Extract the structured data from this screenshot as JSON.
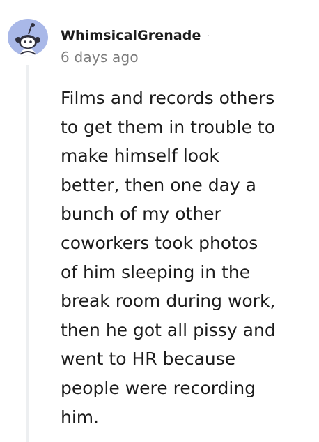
{
  "comment": {
    "username": "WhimsicalGrenade",
    "separator": "·",
    "timestamp": "6 days ago",
    "body_lines": [
      "Films and records others",
      "to get them in trouble to",
      "make himself look",
      "better, then one day a",
      "bunch of my other",
      "coworkers took photos",
      "of him sleeping in the",
      "break room during work,",
      "then he got all pissy and",
      "went to HR because",
      "people were recording",
      "him."
    ],
    "avatar_icon": "reddit-snoo-icon"
  },
  "colors": {
    "avatar_bg": "#a9b8e8",
    "thread_line": "#edeff1",
    "text": "#1c1c1c",
    "muted": "#7c7c7c"
  }
}
